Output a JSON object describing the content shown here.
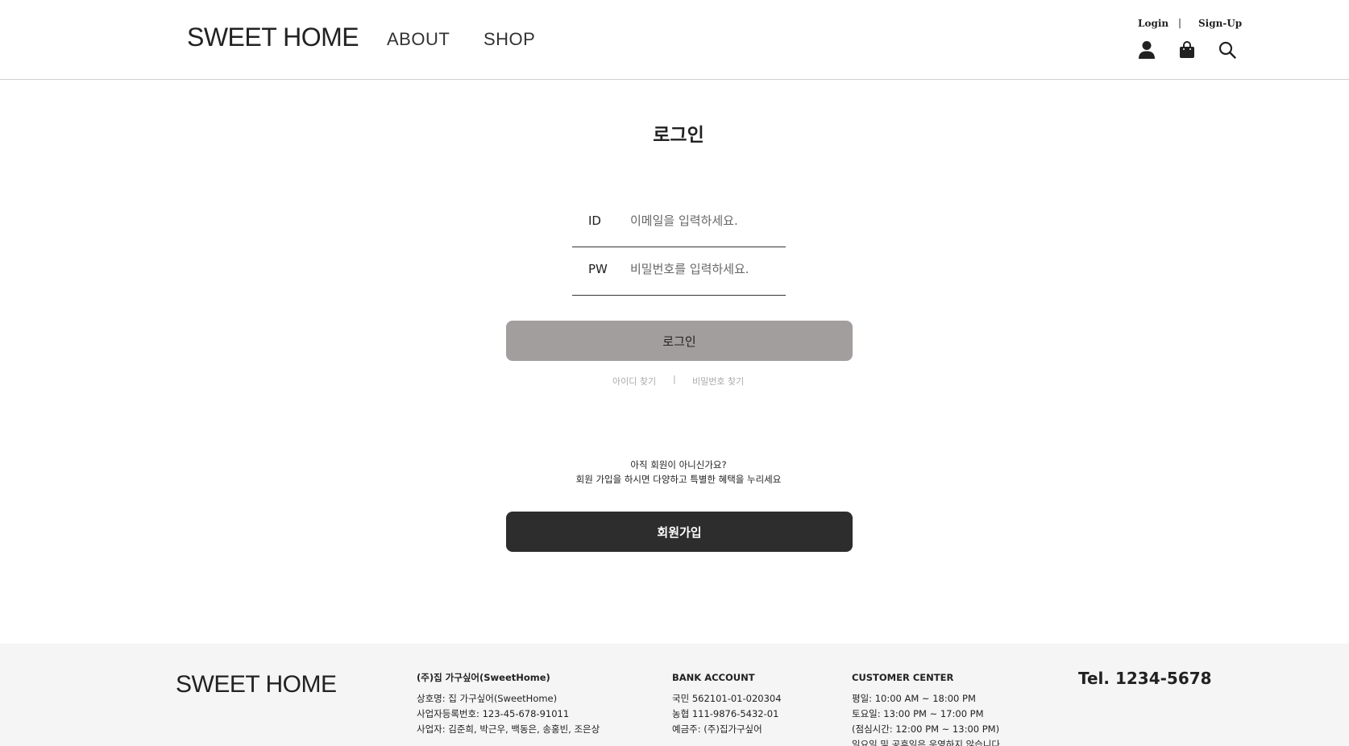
{
  "header": {
    "logo": "SWEET HOME",
    "nav": {
      "about": "ABOUT",
      "shop": "SHOP"
    },
    "util": {
      "login": "Login",
      "separator": "|",
      "signup": "Sign-Up"
    },
    "icons": [
      "user-icon",
      "shopping-bag-icon",
      "search-icon"
    ]
  },
  "main": {
    "title": "로그인",
    "id_field": {
      "label": "ID",
      "placeholder": "이메일을 입력하세요.",
      "value": ""
    },
    "pw_field": {
      "label": "PW",
      "placeholder": "비밀번호를 입력하세요.",
      "value": ""
    },
    "login_button": "로그인",
    "find_id": "아이디 찾기",
    "find_separator": "|",
    "find_pw": "비밀번호 찾기",
    "promo_line1": "아직 회원이 아니신가요?",
    "promo_line2": "회원 가입을 하시면 다양하고 특별한 혜택을 누리세요",
    "signup_button": "회원가입"
  },
  "footer": {
    "logo": "SWEET HOME",
    "company": {
      "heading": "(주)집 가구싶어(SweetHome)",
      "lines": [
        "상호명: 집 가구싶어(SweetHome)",
        "사업자등록번호: 123-45-678-91011",
        "사업자: 김준희, 박근우, 백동은, 송홍빈, 조은상"
      ]
    },
    "bank": {
      "heading": "BANK ACCOUNT",
      "lines": [
        "국민 562101-01-020304",
        "농협 111-9876-5432-01",
        "예금주: (주)집가구싶어"
      ]
    },
    "customer_center": {
      "heading": "CUSTOMER CENTER",
      "lines": [
        "평일: 10:00 AM ~ 18:00 PM",
        "토요일: 13:00 PM ~ 17:00 PM",
        "(점심시간: 12:00 PM ~ 13:00 PM)",
        "일요일 및 공휴일은 운영하지 않습니다."
      ]
    },
    "tel": "Tel. 1234-5678"
  },
  "colors": {
    "login_button_bg": "#a39e9e",
    "signup_button_bg": "#2d2d2d",
    "footer_bg": "#f5f5f5",
    "link_muted": "#aaaaaa"
  }
}
